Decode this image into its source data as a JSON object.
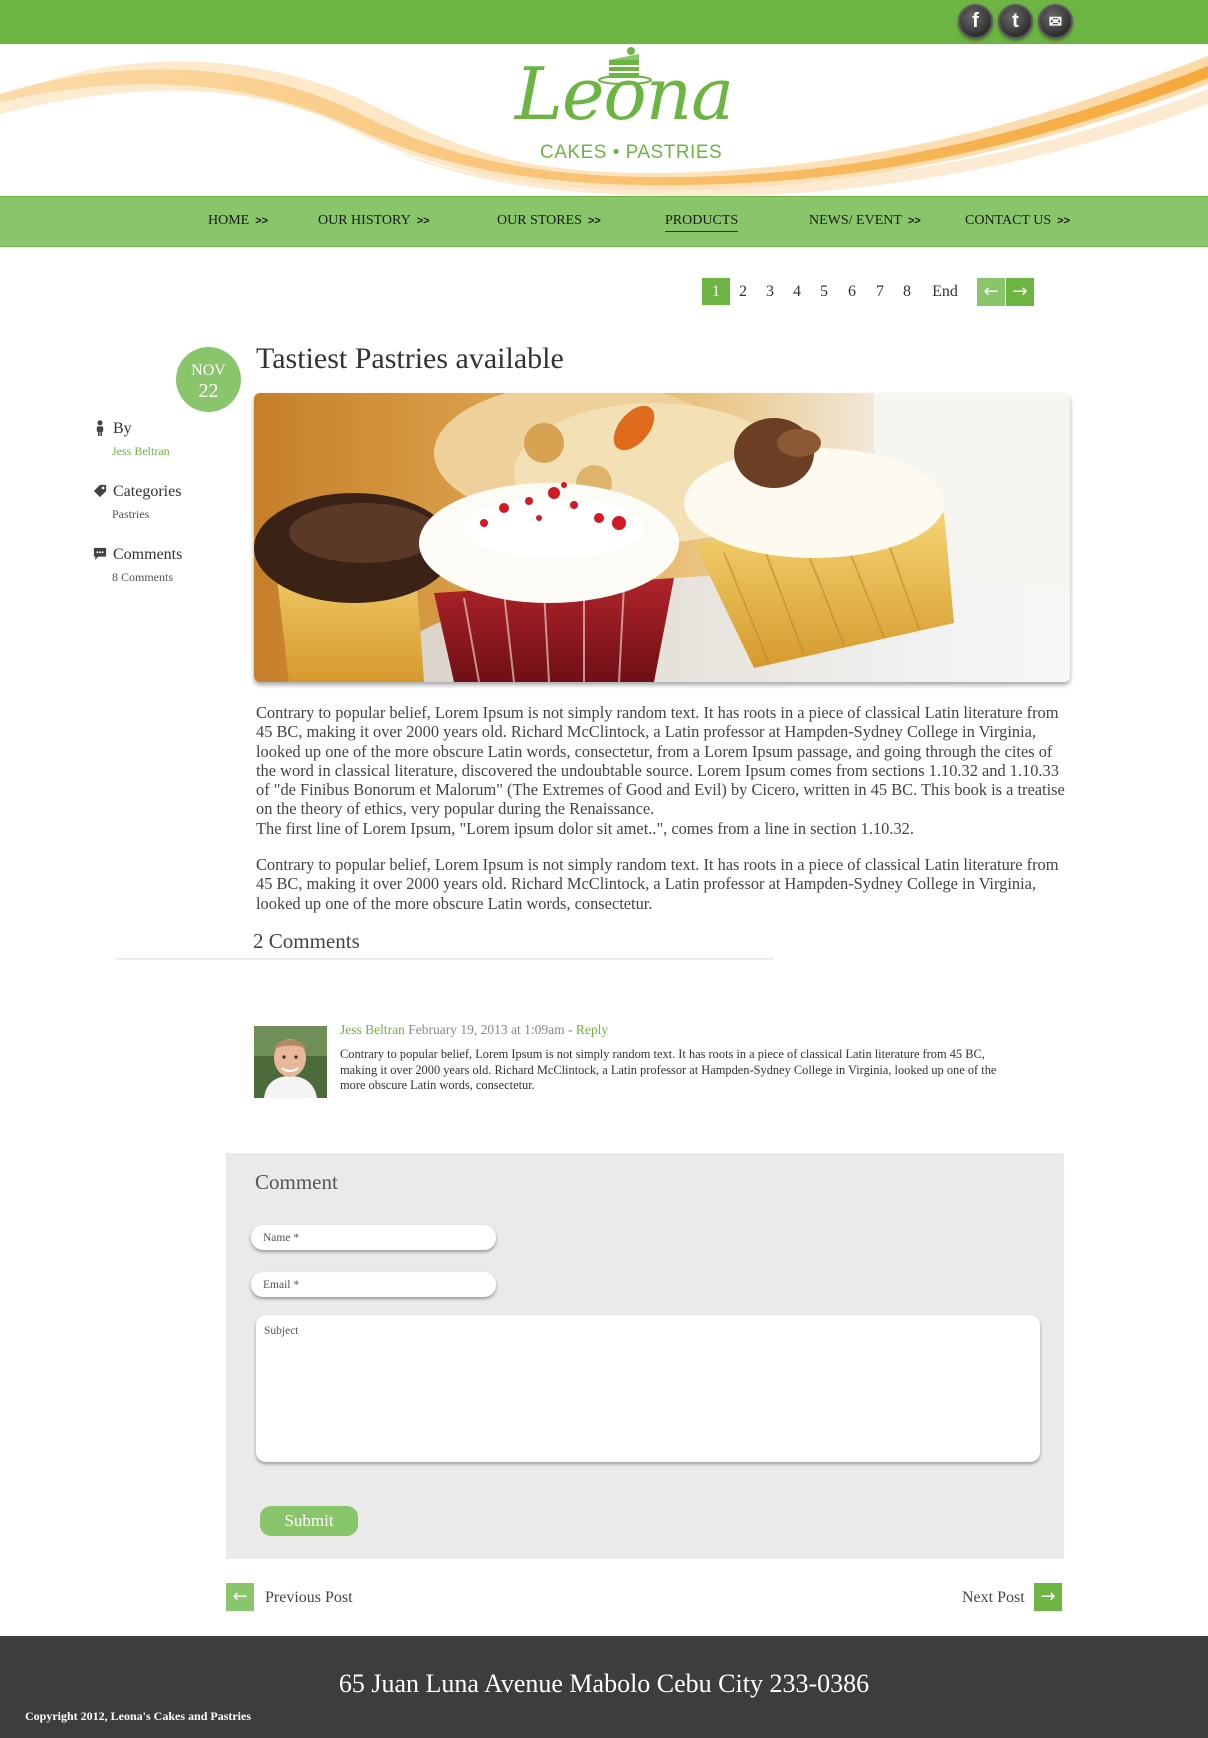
{
  "social": {
    "facebook": "f",
    "twitter": "t",
    "email": "✉"
  },
  "brand": {
    "name": "Leona",
    "tagline": "CAKES • PASTRIES",
    "green": "#6db543",
    "light_green": "#89c56a",
    "orange": "#f7b24d"
  },
  "nav": {
    "items": [
      {
        "label": "HOME",
        "arrow": ">>"
      },
      {
        "label": "OUR HISTORY",
        "arrow": ">>"
      },
      {
        "label": "OUR STORES",
        "arrow": ">>"
      },
      {
        "label": "PRODUCTS",
        "arrow": ""
      },
      {
        "label": "NEWS/ EVENT",
        "arrow": ">>"
      },
      {
        "label": "CONTACT US",
        "arrow": ">>"
      }
    ],
    "active": "PRODUCTS"
  },
  "pagination": {
    "pages": [
      "1",
      "2",
      "3",
      "4",
      "5",
      "6",
      "7",
      "8"
    ],
    "current": "1",
    "end_label": "End",
    "prev_icon": "←",
    "next_icon": "→"
  },
  "post": {
    "month": "NOV",
    "day": "22",
    "title": "Tastiest Pastries available",
    "by_label": "By",
    "author": "Jess Beltran",
    "categories_label": "Categories",
    "category": "Pastries",
    "comments_label": "Comments",
    "comments_count": "8 Comments",
    "paragraph1": "Contrary to popular belief, Lorem Ipsum is not simply random text. It has roots in a piece of classical Latin literature from 45 BC, making it over 2000 years old. Richard McClintock, a Latin professor at Hampden-Sydney College in Virginia, looked up one of the more obscure Latin words, consectetur, from a Lorem Ipsum passage, and going through the cites of the word in classical literature, discovered the undoubtable source. Lorem Ipsum comes from sections 1.10.32 and 1.10.33 of \"de Finibus Bonorum et Malorum\" (The Extremes of Good and Evil) by Cicero, written in 45 BC. This book is a treatise on the theory of ethics, very popular during the Renaissance.",
    "paragraph1b": "The first line of Lorem Ipsum, \"Lorem ipsum dolor sit amet..\", comes from a line in section 1.10.32.",
    "paragraph2": "Contrary to popular belief, Lorem Ipsum is not simply random text. It has roots in a piece of classical Latin literature from 45 BC, making it over 2000 years old. Richard McClintock, a Latin professor at Hampden-Sydney College in Virginia, looked up one of the more obscure Latin words, consectetur."
  },
  "comments": {
    "title": "2 Comments",
    "items": [
      {
        "author": "Jess Beltran",
        "date": "February 19, 2013 at 1:09am",
        "separator": " - ",
        "reply": "Reply",
        "text": "Contrary to popular belief, Lorem Ipsum is not simply random text. It has roots in a piece of classical Latin literature from 45 BC, making it over 2000 years old. Richard McClintock, a Latin professor at Hampden-Sydney College in Virginia, looked up one of the more obscure Latin words, consectetur."
      }
    ]
  },
  "form": {
    "title": "Comment",
    "name_placeholder": "Name *",
    "email_placeholder": "Email *",
    "subject_placeholder": "Subject",
    "submit_label": "Submit"
  },
  "post_nav": {
    "previous": "Previous Post",
    "next": "Next Post",
    "prev_icon": "←",
    "next_icon": "→"
  },
  "footer": {
    "address": "65 Juan Luna Avenue Mabolo Cebu City 233-0386",
    "copyright": "Copyright 2012, Leona's Cakes and Pastries"
  }
}
